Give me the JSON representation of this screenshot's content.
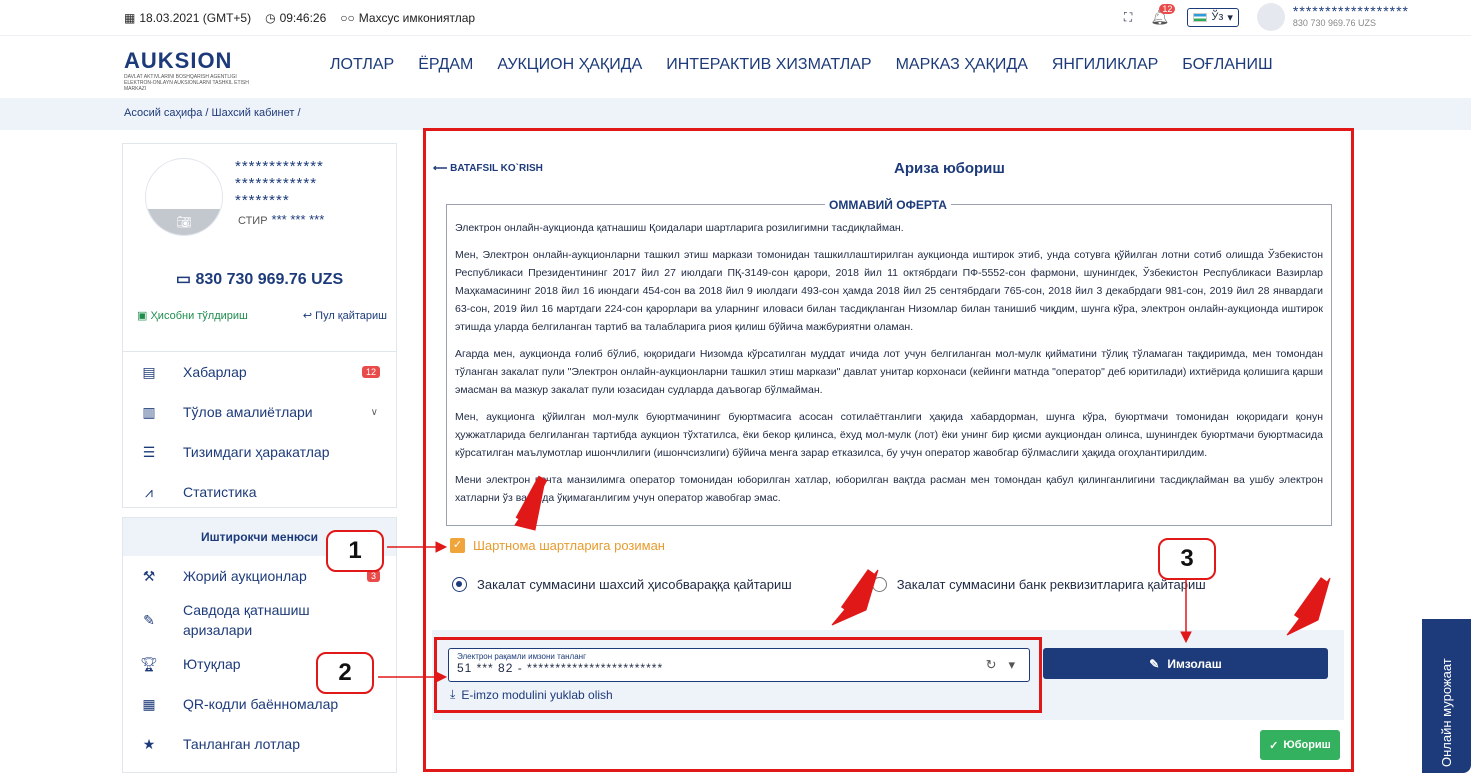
{
  "topbar": {
    "date": "18.03.2021 (GMT+5)",
    "time": "09:46:26",
    "special": "Махсус имкониятлар",
    "bell_count": "12",
    "lang": "Ўз",
    "user_stars": "******************",
    "user_balance": "830 730 969.76 UZS"
  },
  "header": {
    "logo": "AUKSION",
    "logo_sub": "DAVLAT AKTIVLARINI BOSHQARISH AGENTLIGI ELEKTRON-ONLAYN AUKSIONLARNI TASHKIL ETISH MARKAZI",
    "nav": [
      "ЛОТЛАР",
      "ЁРДАМ",
      "АУКЦИОН ҲАҚИДА",
      "ИНТЕРАКТИВ ХИЗМАТЛАР",
      "МАРКАЗ ҲАҚИДА",
      "ЯНГИЛИКЛАР",
      "БОҒЛАНИШ"
    ]
  },
  "breadcrumb": "Асосий саҳифа  /  Шахсий кабинет  /",
  "profile": {
    "name1": "*************",
    "name2": "************",
    "name3": "********",
    "stir_label": "СТИР",
    "stir_value": "*** *** ***",
    "balance": "830 730 969.76 UZS",
    "topup": "Ҳисобни тўлдириш",
    "refund": "Пул қайтариш"
  },
  "menu": [
    {
      "label": "Хабарлар",
      "badge": "12"
    },
    {
      "label": "Тўлов амалиётлари"
    },
    {
      "label": "Тизимдаги ҳаракатлар"
    },
    {
      "label": "Статистика"
    }
  ],
  "participant": {
    "title": "Иштирокчи менюси",
    "items": [
      "Жорий аукционлар",
      "Савдода қатнашиш аризалари",
      "Ютуқлар",
      "QR-кодли баённомалар",
      "Танланган лотлар"
    ],
    "badge": "3"
  },
  "form": {
    "back": "BATAFSIL KO`RISH",
    "title": "Ариза юбориш",
    "offer_title": "ОММАВИЙ ОФЕРТА",
    "paragraphs": [
      "Электрон онлайн-аукционда қатнашиш Қоидалари шартларига розилигимни тасдиқлайман.",
      "Мен, Электрон онлайн-аукционларни ташкил этиш маркази томонидан ташкиллаштирилган аукционда иштирок этиб, унда сотувга қўйилган лотни сотиб олишда Ўзбекистон Республикаси Президентининг 2017 йил 27 июлдаги ПҚ-3149-сон қарори, 2018 йил 11 октябрдаги ПФ-5552-сон фармони, шунингдек, Ўзбекистон Республикаси Вазирлар Маҳкамасининг 2018 йил 16 июндаги 454-сон ва 2018 йил 9 июлдаги 493-сон ҳамда 2018 йил 25 сентябрдаги 765-сон, 2018 йил 3 декабрдаги 981-сон, 2019 йил 28 январдаги 63-сон, 2019 йил 16 мартдаги 224-сон қарорлари ва уларнинг иловаси билан тасдиқланган Низомлар билан танишиб чиқдим, шунга кўра, электрон онлайн-аукционда иштирок этишда уларда белгиланган тартиб ва талабларига риоя қилиш бўйича мажбуриятни оламан.",
      "Агарда мен, аукционда ғолиб бўлиб, юқоридаги Низомда кўрсатилган муддат ичида лот учун белгиланган мол-мулк қийматини тўлиқ тўламаган тақдиримда, мен томондан тўланган закалат пули \"Электрон онлайн-аукционларни ташкил этиш маркази\" давлат унитар корхонаси (кейинги матнда \"оператор\" деб юритилади) ихтиёрида қолишига қарши эмасман ва мазкур закалат пули юзасидан судларда даъвогар бўлмайман.",
      "Мен, аукционга қўйилган мол-мулк буюртмачининг буюртмасига асосан сотилаётганлиги ҳақида хабардорман, шунга кўра, буюртмачи томонидан юқоридаги қонун ҳужжатларида белгиланган тартибда аукцион тўхтатилса, ёки бекор қилинса, ёхуд мол-мулк (лот) ёки унинг бир қисми аукциондан олинса, шунингдек буюртмачи буюртмасида кўрсатилган маълумотлар ишончлилиги (ишончсизлиги) бўйича менга зарар етказилса, бу учун оператор жавобгар бўлмаслиги ҳақида огоҳлантирилдим.",
      "Мени электрон почта манзилимга оператор томонидан юборилган хатлар, юборилган вақтда расман мен томондан қабул қилинганлигини тасдиқлайман ва ушбу электрон хатларни ўз вақтида ўқимаганлигим учун оператор жавобгар эмас."
    ],
    "agree": "Шартнома шартларига розиман",
    "radio1": "Закалат суммасини шахсий ҳисобвараққа қайтариш",
    "radio2": "Закалат суммасини банк реквизитларига қайтариш",
    "sign_label": "Электрон рақамли имзони танланг",
    "sign_value": "51 *** 82 -   ************************",
    "download": "E-imzo modulini yuklab olish",
    "sign_btn": "Имзолаш",
    "send_btn": "Юбориш"
  },
  "side_tab": "Онлайн мурожаат",
  "annotations": [
    "1",
    "2",
    "3"
  ]
}
